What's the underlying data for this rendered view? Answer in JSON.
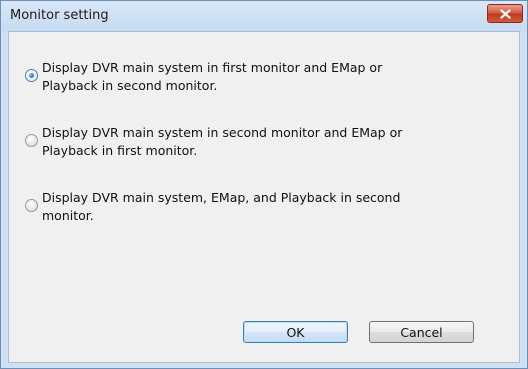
{
  "window": {
    "title": "Monitor setting",
    "close_label": "x"
  },
  "options": [
    {
      "line1": "Display DVR main system in first monitor and EMap or",
      "line2": "Playback in second monitor.",
      "selected": true
    },
    {
      "line1": "Display DVR main system in second monitor and EMap or",
      "line2": "Playback in first monitor.",
      "selected": false
    },
    {
      "line1": "Display DVR main system, EMap, and Playback in second",
      "line2": "monitor.",
      "selected": false
    }
  ],
  "buttons": {
    "ok_label": "OK",
    "cancel_label": "Cancel"
  },
  "colors": {
    "close_button": "#c7432a",
    "radio_selected": "#2c6fbf",
    "ok_border": "#3c7fb1"
  },
  "icons": {
    "close": "close-icon",
    "radio": "radio-button"
  }
}
